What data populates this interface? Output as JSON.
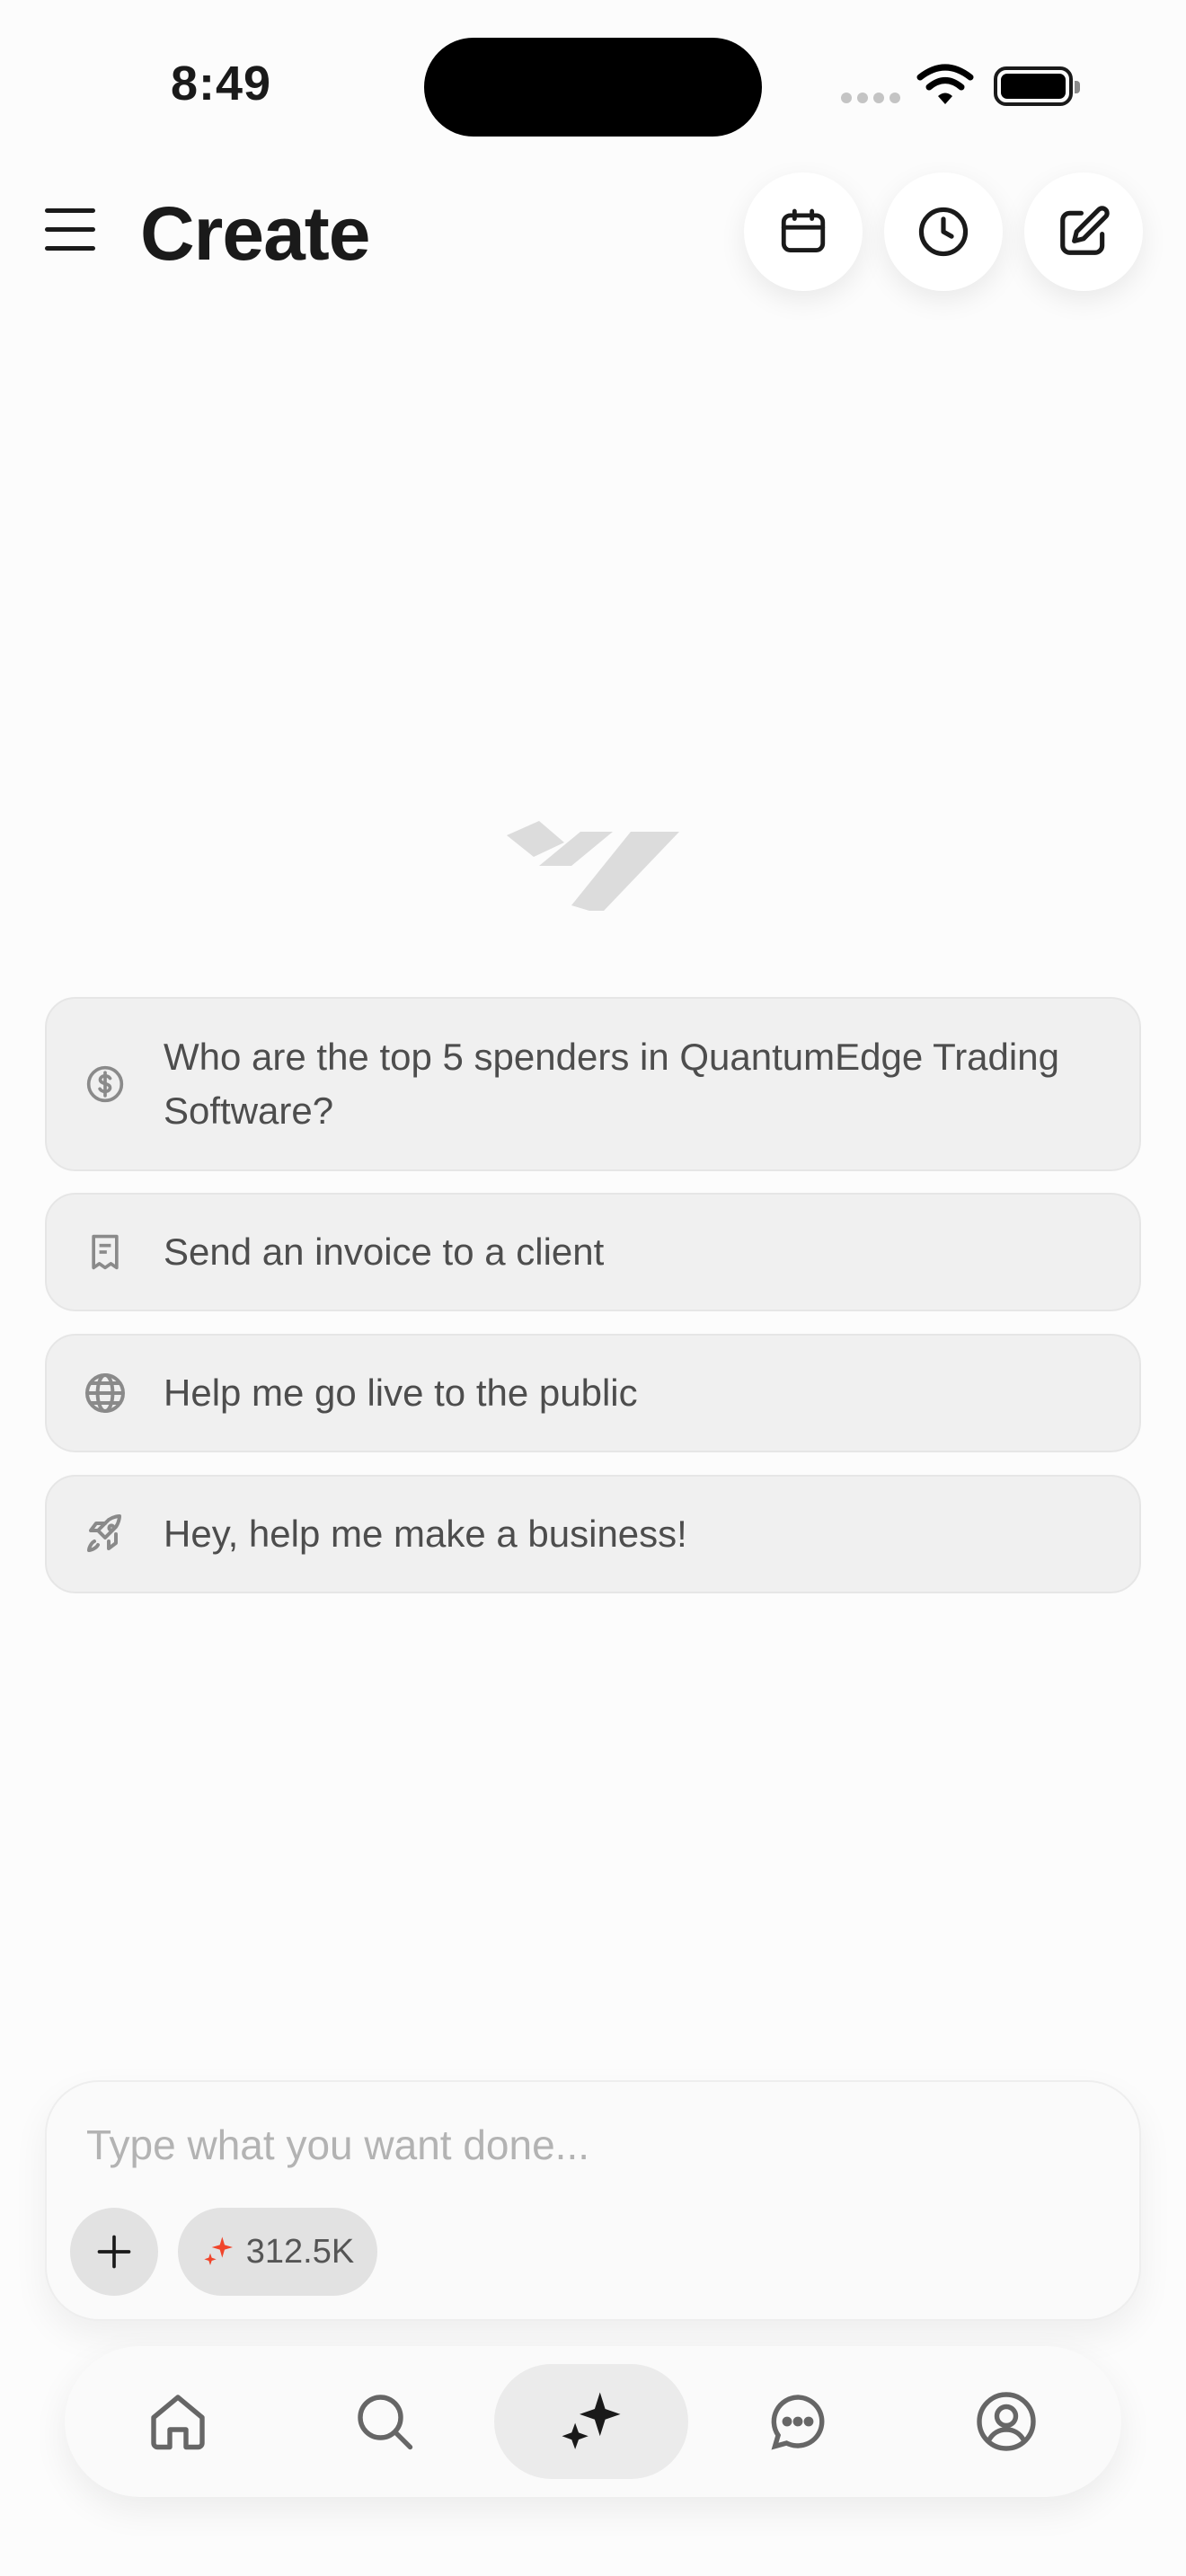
{
  "status_bar": {
    "time": "8:49"
  },
  "header": {
    "title": "Create",
    "icons": [
      "menu-icon",
      "calendar-icon",
      "clock-icon",
      "edit-icon"
    ]
  },
  "suggestions": [
    {
      "icon": "dollar-circle-icon",
      "text": "Who are the top 5 spenders in QuantumEdge Trading Software?"
    },
    {
      "icon": "receipt-icon",
      "text": "Send an invoice to a client"
    },
    {
      "icon": "globe-icon",
      "text": "Help me go live to the public"
    },
    {
      "icon": "rocket-icon",
      "text": "Hey, help me make a business!"
    }
  ],
  "composer": {
    "placeholder": "Type what you want done...",
    "value": "",
    "credits": "312.5K",
    "credits_icon": "sparkle-icon",
    "accent": "#f0452b"
  },
  "tabbar": {
    "items": [
      "home-icon",
      "search-icon",
      "sparkles-icon",
      "chat-icon",
      "profile-icon"
    ],
    "active": "sparkles-icon"
  }
}
